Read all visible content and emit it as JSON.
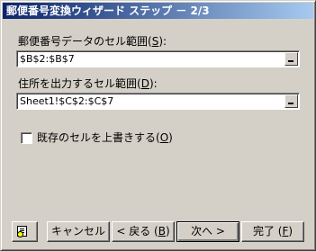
{
  "window": {
    "title": "郵便番号変換ウィザード ステップ － 2/3"
  },
  "zip_range": {
    "label": "郵便番号データのセル範囲(",
    "mnemonic": "S",
    "label_end": "):",
    "value": "$B$2:$B$7"
  },
  "address_range": {
    "label": "住所を出力するセル範囲(",
    "mnemonic": "D",
    "label_end": "):",
    "value": "Sheet1!$C$2:$C$7"
  },
  "overwrite": {
    "label": "既存のセルを上書きする(",
    "mnemonic": "O",
    "label_end": ")",
    "checked": false
  },
  "buttons": {
    "help_icon": "help-icon",
    "cancel": "キャンセル",
    "back": "< 戻る (",
    "back_mnemonic": "B",
    "back_end": ")",
    "next": "次へ >",
    "finish": "完了 (",
    "finish_mnemonic": "F",
    "finish_end": ")"
  }
}
